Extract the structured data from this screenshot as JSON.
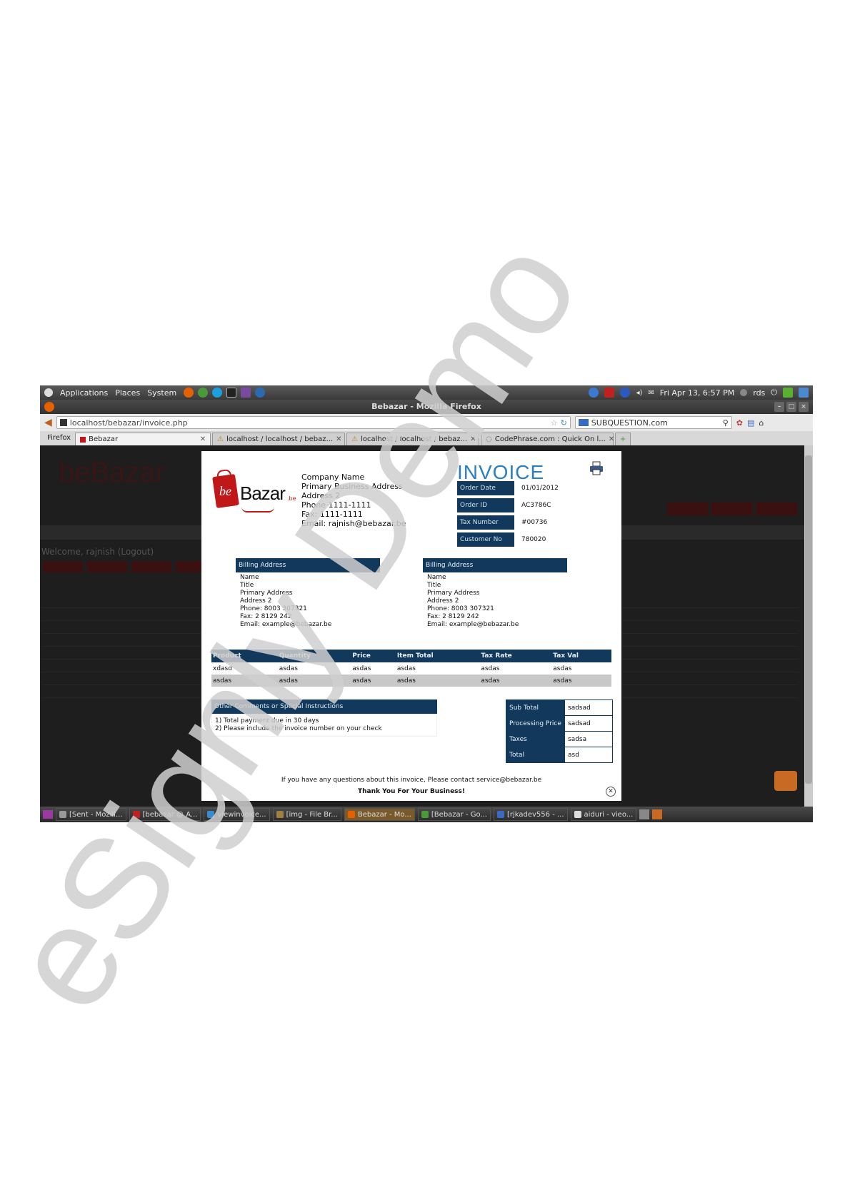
{
  "gnome_panel": {
    "menus": [
      "Applications",
      "Places",
      "System"
    ],
    "clock": "Fri Apr 13, 6:57 PM",
    "user": "rds"
  },
  "window": {
    "title": "Bebazar - Mozilla Firefox"
  },
  "navbar": {
    "url": "localhost/bebazar/invoice.php",
    "search_engine": "SUBQUESTION.com",
    "search_placeholder": ""
  },
  "tabs": {
    "firefox_menu": "Firefox",
    "items": [
      {
        "label": "Bebazar",
        "active": true
      },
      {
        "label": "localhost / localhost / bebaz...",
        "active": false
      },
      {
        "label": "localhost / localhost / bebaz...",
        "active": false
      },
      {
        "label": "CodePhrase.com : Quick On l...",
        "active": false
      }
    ]
  },
  "background": {
    "logo": "beBazar",
    "welcome": "Welcome, rajnish (Logout)"
  },
  "invoice": {
    "company": {
      "name": "Company Name",
      "address1": "Primary Business Address",
      "address2": "Address 2",
      "phone": "Phone 1111-1111",
      "fax": "Fax: 1111-1111",
      "email": "Email: rajnish@bebazar.be"
    },
    "title": "INVOICE",
    "meta": [
      {
        "label": "Order Date",
        "value": "01/01/2012"
      },
      {
        "label": "Order ID",
        "value": "AC3786C"
      },
      {
        "label": "Tax Number",
        "value": "#00736"
      },
      {
        "label": "Customer No",
        "value": "780020"
      }
    ],
    "billing": {
      "heading": "Billing Address",
      "lines": [
        "Name",
        "Title",
        "Primary Address",
        "Address 2",
        "Phone: 8003 307321",
        "Fax: 2 8129 242",
        "Email: example@bebazar.be"
      ]
    },
    "shipping": {
      "heading": "Billing Address",
      "lines": [
        "Name",
        "Title",
        "Primary Address",
        "Address 2",
        "Phone: 8003 307321",
        "Fax: 2 8129 242",
        "Email: example@bebazar.be"
      ]
    },
    "table": {
      "headers": [
        "Product",
        "Quantity",
        "Price",
        "Item Total",
        "Tax Rate",
        "Tax Val"
      ],
      "rows": [
        [
          "xdasd",
          "asdas",
          "asdas",
          "asdas",
          "asdas",
          "asdas"
        ],
        [
          "asdas",
          "asdas",
          "asdas",
          "asdas",
          "asdas",
          "asdas"
        ]
      ]
    },
    "comments": {
      "heading": "Other Comments or Special Instructions",
      "lines": [
        "1) Total payment due in 30 days",
        "2) Please include the invoice number on your check"
      ]
    },
    "totals": [
      {
        "label": "Sub Total",
        "value": "sadsad"
      },
      {
        "label": "Processing Price",
        "value": "sadsad"
      },
      {
        "label": "Taxes",
        "value": "sadsa"
      },
      {
        "label": "Total",
        "value": "asd"
      }
    ],
    "footer_note": "If you have any questions about this invoice, Please contact service@bebazar.be",
    "footer_thanks": "Thank You For Your Business!"
  },
  "taskbar": {
    "items": [
      {
        "label": "[Sent - Mozill...",
        "active": false
      },
      {
        "label": "[bebazar @ A...",
        "active": false
      },
      {
        "label": "viewinvoice...",
        "active": false
      },
      {
        "label": "[img - File Br...",
        "active": false
      },
      {
        "label": "Bebazar - Mo...",
        "active": true
      },
      {
        "label": "[Bebazar - Go...",
        "active": false
      },
      {
        "label": "[rjkadev556 - ...",
        "active": false
      },
      {
        "label": "aiduri - vieo...",
        "active": false
      }
    ]
  },
  "watermark": {
    "text": "eSignly Demo",
    "color": "#cfcfcf"
  }
}
